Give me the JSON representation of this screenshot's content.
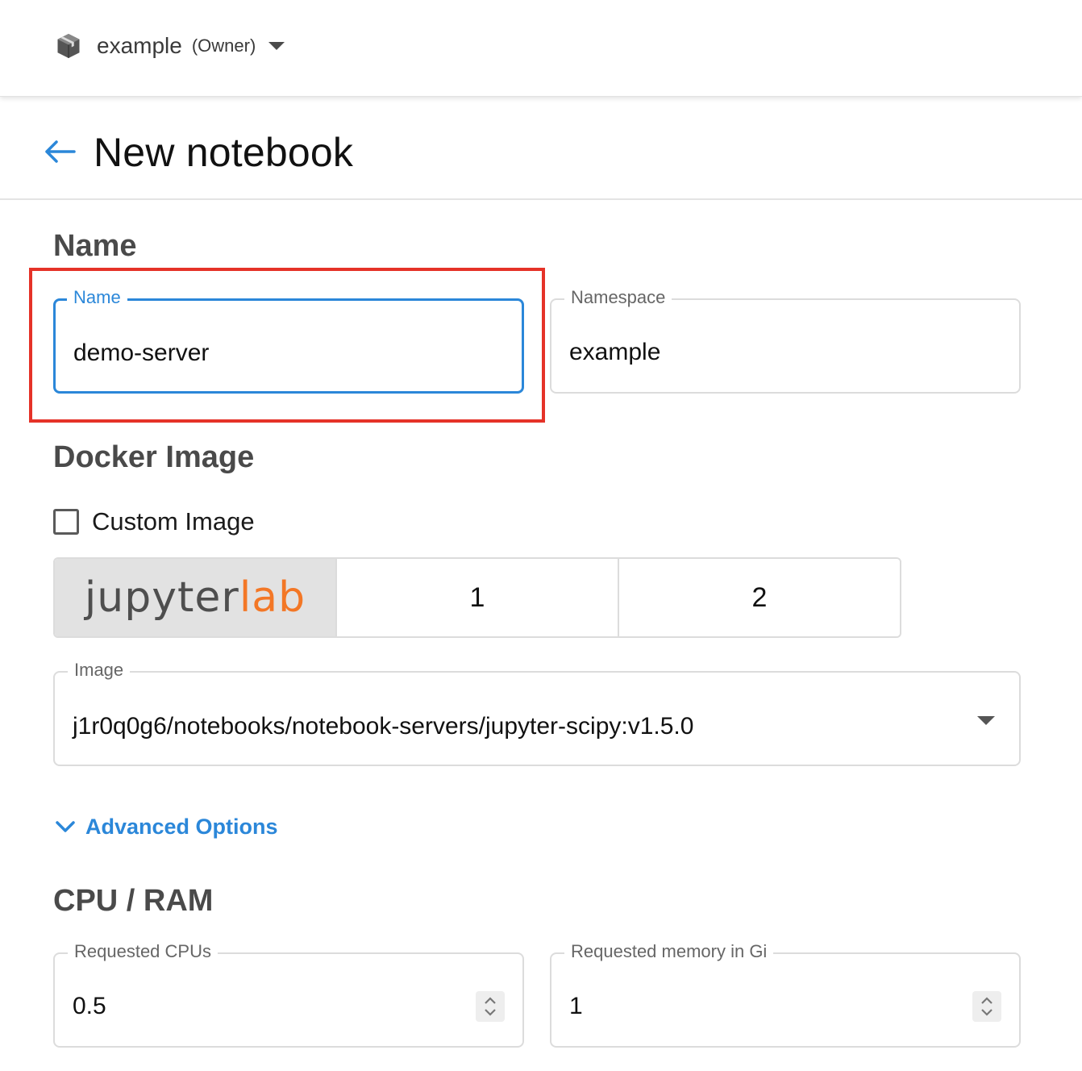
{
  "topbar": {
    "namespace": "example",
    "role": "(Owner)"
  },
  "header": {
    "title": "New notebook"
  },
  "name_section": {
    "title": "Name",
    "name_field": {
      "label": "Name",
      "value": "demo-server"
    },
    "namespace_field": {
      "label": "Namespace",
      "value": "example"
    }
  },
  "image_section": {
    "title": "Docker Image",
    "custom_image": {
      "label": "Custom Image",
      "checked": false
    },
    "options": [
      {
        "jupyter": "jupyter",
        "lab": "lab"
      },
      {
        "label": "1"
      },
      {
        "label": "2"
      }
    ],
    "image_field": {
      "label": "Image",
      "value": "j1r0q0g6/notebooks/notebook-servers/jupyter-scipy:v1.5.0"
    }
  },
  "advanced": {
    "label": "Advanced Options"
  },
  "resources": {
    "title": "CPU / RAM",
    "cpu": {
      "label": "Requested CPUs",
      "value": "0.5"
    },
    "memory": {
      "label": "Requested memory in Gi",
      "value": "1"
    }
  },
  "colors": {
    "accent": "#2b87d9",
    "highlight": "#e53228",
    "jupyterlab_orange": "#f37726"
  }
}
